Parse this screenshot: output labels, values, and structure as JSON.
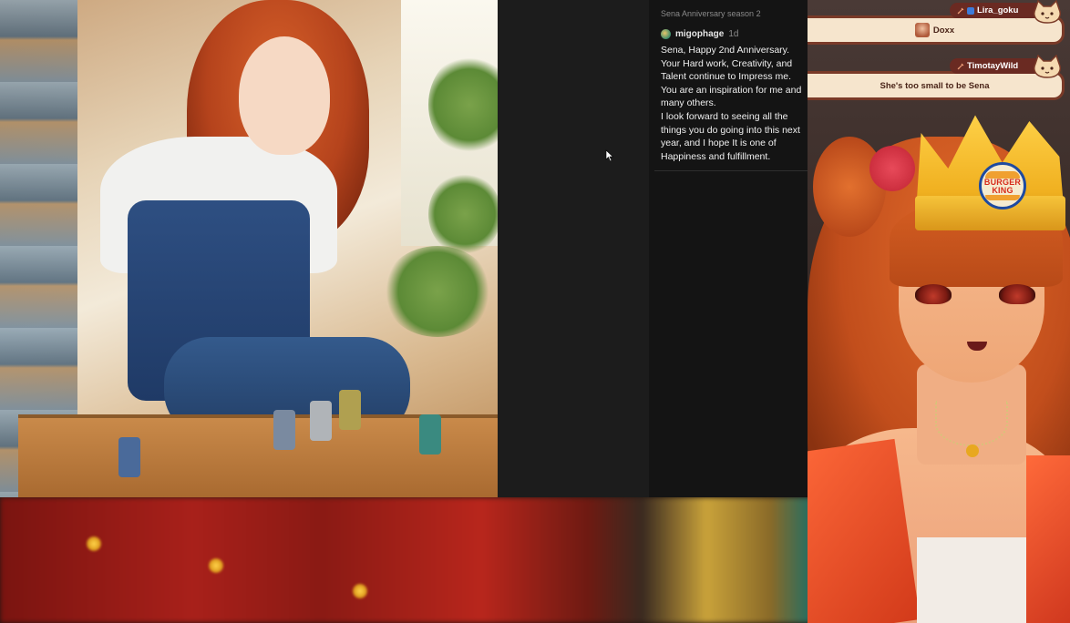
{
  "artwork": {
    "description_icon": "watercolor-artwork"
  },
  "comment_panel": {
    "title": "Sena Anniversary season 2",
    "comment": {
      "username": "migophage",
      "time": "1d",
      "paragraphs": [
        "Sena, Happy 2nd Anniversary. Your Hard work, Creativity, and Talent continue to Impress me. You are an inspiration for me and many others.",
        "I look forward to seeing all the things you do going into this next year, and I hope It is one of Happiness and fulfillment."
      ]
    }
  },
  "chat": {
    "messages": [
      {
        "username": "Lira_goku",
        "text": "Doxx",
        "has_emote": true
      },
      {
        "username": "TimotayWild",
        "text": "She's too small to be Sena",
        "has_emote": false
      }
    ]
  },
  "vtuber": {
    "crown_logo_top": "BURGER",
    "crown_logo_bottom": "KING"
  },
  "colors": {
    "panel_bg": "#141414",
    "chat_card_bg": "#f6e5cd",
    "chat_name_bg": "#6a2a22",
    "accent_orange": "#e06a2a"
  }
}
